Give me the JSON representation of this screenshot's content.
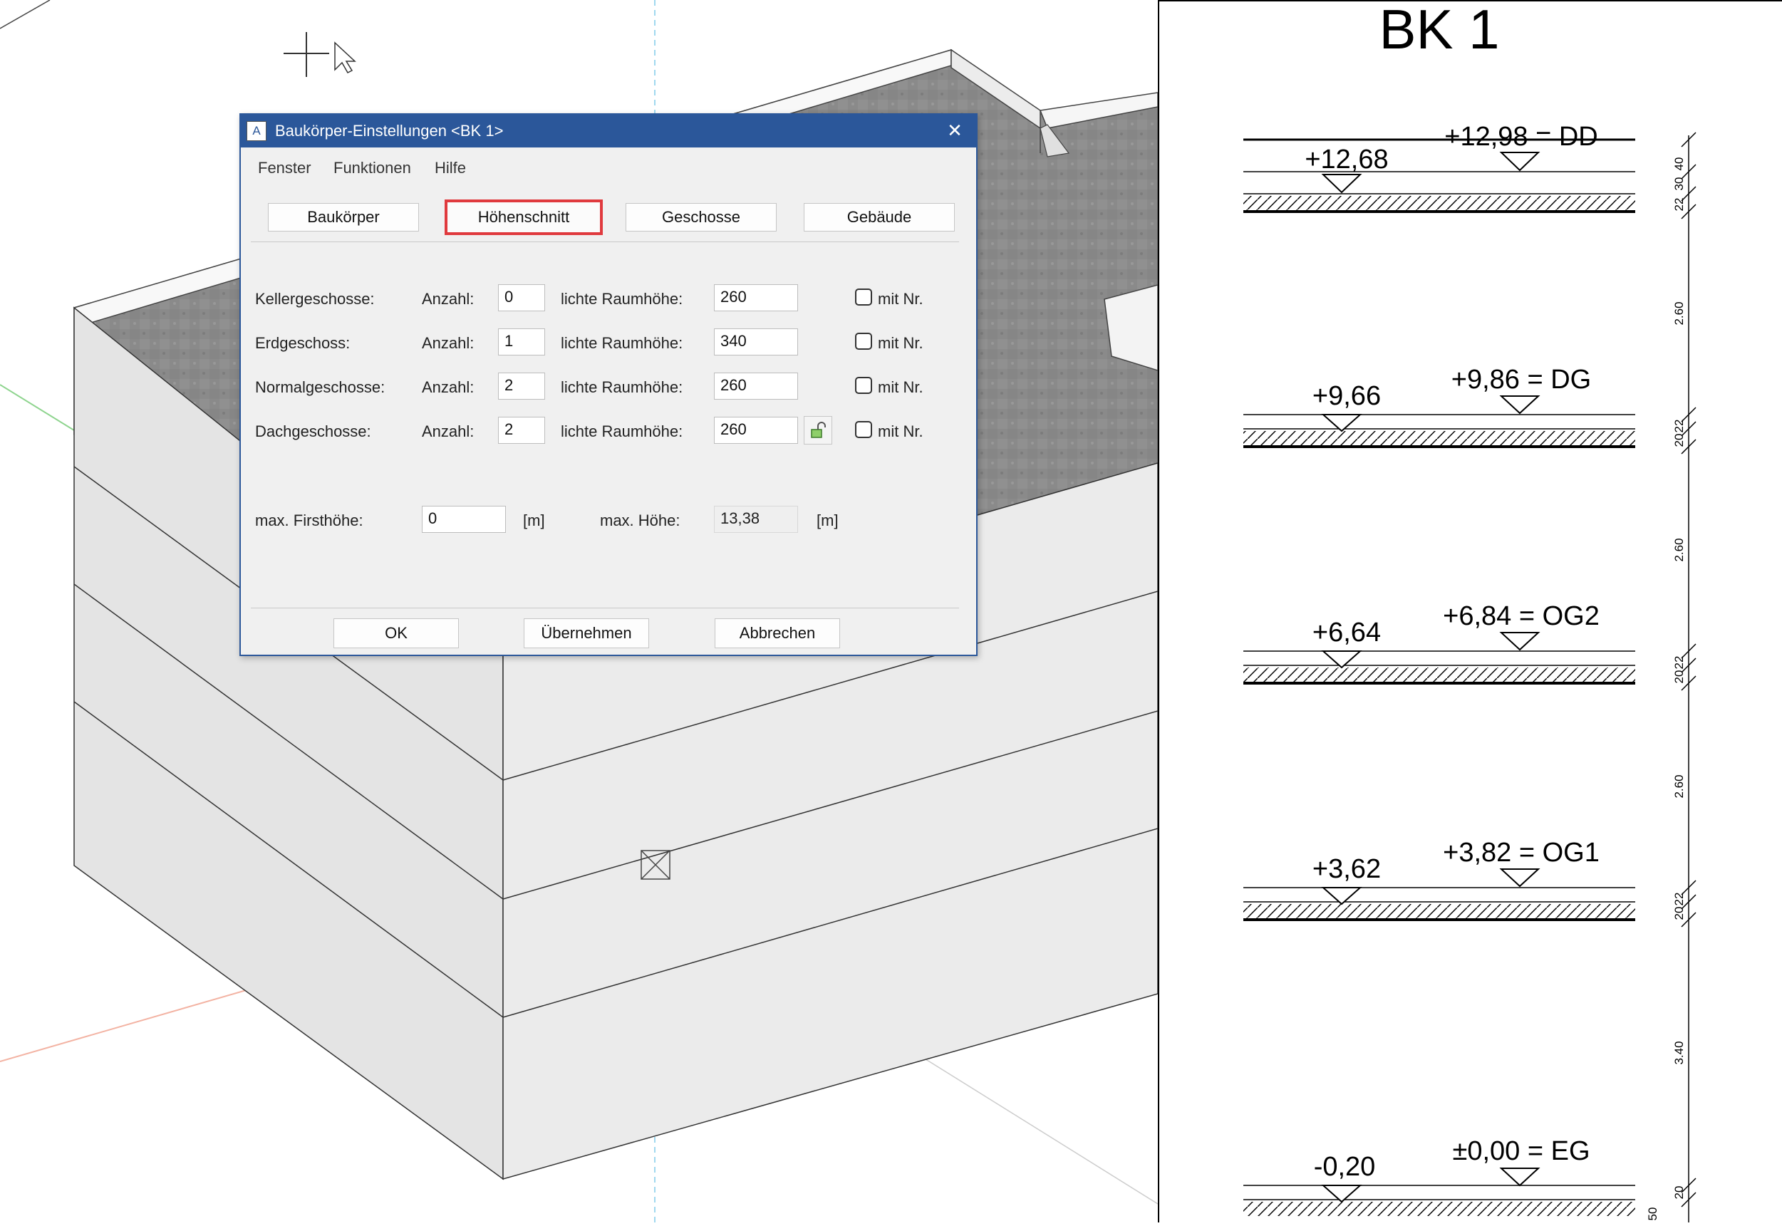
{
  "dialog": {
    "title": "Baukörper-Einstellungen <BK 1>",
    "icon": "app-icon",
    "close_label": "✕",
    "menu": [
      "Fenster",
      "Funktionen",
      "Hilfe"
    ],
    "tabs": [
      "Baukörper",
      "Höhenschnitt",
      "Geschosse",
      "Gebäude"
    ],
    "active_tab": "Höhenschnitt",
    "rows": [
      {
        "label": "Kellergeschosse:",
        "count_label": "Anzahl:",
        "count": "0",
        "height_label": "lichte Raumhöhe:",
        "height": "260",
        "checkbox_label": "mit Nr.",
        "checked": false
      },
      {
        "label": "Erdgeschoss:",
        "count_label": "Anzahl:",
        "count": "1",
        "height_label": "lichte Raumhöhe:",
        "height": "340",
        "checkbox_label": "mit Nr.",
        "checked": false
      },
      {
        "label": "Normalgeschosse:",
        "count_label": "Anzahl:",
        "count": "2",
        "height_label": "lichte Raumhöhe:",
        "height": "260",
        "checkbox_label": "mit Nr.",
        "checked": false
      },
      {
        "label": "Dachgeschosse:",
        "count_label": "Anzahl:",
        "count": "2",
        "height_label": "lichte Raumhöhe:",
        "height": "260",
        "checkbox_label": "mit Nr.",
        "checked": false
      }
    ],
    "lock_icon": "unlock-icon",
    "max_ridge_label": "max. Firsthöhe:",
    "max_ridge_value": "0",
    "unit1": "[m]",
    "max_height_label": "max. Höhe:",
    "max_height_value": "13,38",
    "unit2": "[m]",
    "buttons": {
      "ok": "OK",
      "apply": "Übernehmen",
      "cancel": "Abbrechen"
    }
  },
  "section": {
    "title": "BK 1",
    "levels": [
      {
        "left": "+12,68",
        "right": "+12,98 = DD"
      },
      {
        "left": "+9,66",
        "right": "+9,86 = DG"
      },
      {
        "left": "+6,64",
        "right": "+6,84 = OG2"
      },
      {
        "left": "+3,62",
        "right": "+3,82 = OG1"
      },
      {
        "left": "-0,20",
        "right": "±0,00 = EG"
      }
    ],
    "dims": {
      "top": [
        "40",
        "30",
        "22"
      ],
      "floor": "2.60",
      "eg_floor": "3.40",
      "slab": [
        "22",
        "20"
      ],
      "bottom": [
        "20",
        "50"
      ]
    }
  },
  "colors": {
    "titlebar": "#2b579a",
    "highlight": "#e03a3e",
    "dialog_bg": "#f0f0f0"
  }
}
